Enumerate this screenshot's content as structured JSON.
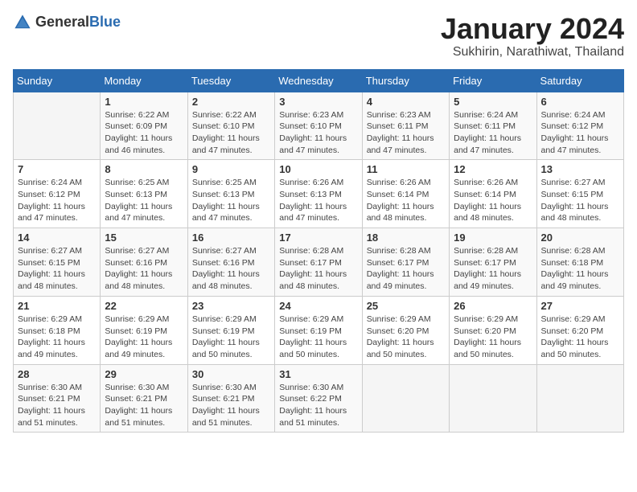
{
  "logo": {
    "text_general": "General",
    "text_blue": "Blue"
  },
  "title": "January 2024",
  "subtitle": "Sukhirin, Narathiwat, Thailand",
  "days_of_week": [
    "Sunday",
    "Monday",
    "Tuesday",
    "Wednesday",
    "Thursday",
    "Friday",
    "Saturday"
  ],
  "weeks": [
    [
      {
        "day": "",
        "detail": ""
      },
      {
        "day": "1",
        "detail": "Sunrise: 6:22 AM\nSunset: 6:09 PM\nDaylight: 11 hours\nand 46 minutes."
      },
      {
        "day": "2",
        "detail": "Sunrise: 6:22 AM\nSunset: 6:10 PM\nDaylight: 11 hours\nand 47 minutes."
      },
      {
        "day": "3",
        "detail": "Sunrise: 6:23 AM\nSunset: 6:10 PM\nDaylight: 11 hours\nand 47 minutes."
      },
      {
        "day": "4",
        "detail": "Sunrise: 6:23 AM\nSunset: 6:11 PM\nDaylight: 11 hours\nand 47 minutes."
      },
      {
        "day": "5",
        "detail": "Sunrise: 6:24 AM\nSunset: 6:11 PM\nDaylight: 11 hours\nand 47 minutes."
      },
      {
        "day": "6",
        "detail": "Sunrise: 6:24 AM\nSunset: 6:12 PM\nDaylight: 11 hours\nand 47 minutes."
      }
    ],
    [
      {
        "day": "7",
        "detail": "Sunrise: 6:24 AM\nSunset: 6:12 PM\nDaylight: 11 hours\nand 47 minutes."
      },
      {
        "day": "8",
        "detail": "Sunrise: 6:25 AM\nSunset: 6:13 PM\nDaylight: 11 hours\nand 47 minutes."
      },
      {
        "day": "9",
        "detail": "Sunrise: 6:25 AM\nSunset: 6:13 PM\nDaylight: 11 hours\nand 47 minutes."
      },
      {
        "day": "10",
        "detail": "Sunrise: 6:26 AM\nSunset: 6:13 PM\nDaylight: 11 hours\nand 47 minutes."
      },
      {
        "day": "11",
        "detail": "Sunrise: 6:26 AM\nSunset: 6:14 PM\nDaylight: 11 hours\nand 48 minutes."
      },
      {
        "day": "12",
        "detail": "Sunrise: 6:26 AM\nSunset: 6:14 PM\nDaylight: 11 hours\nand 48 minutes."
      },
      {
        "day": "13",
        "detail": "Sunrise: 6:27 AM\nSunset: 6:15 PM\nDaylight: 11 hours\nand 48 minutes."
      }
    ],
    [
      {
        "day": "14",
        "detail": "Sunrise: 6:27 AM\nSunset: 6:15 PM\nDaylight: 11 hours\nand 48 minutes."
      },
      {
        "day": "15",
        "detail": "Sunrise: 6:27 AM\nSunset: 6:16 PM\nDaylight: 11 hours\nand 48 minutes."
      },
      {
        "day": "16",
        "detail": "Sunrise: 6:27 AM\nSunset: 6:16 PM\nDaylight: 11 hours\nand 48 minutes."
      },
      {
        "day": "17",
        "detail": "Sunrise: 6:28 AM\nSunset: 6:17 PM\nDaylight: 11 hours\nand 48 minutes."
      },
      {
        "day": "18",
        "detail": "Sunrise: 6:28 AM\nSunset: 6:17 PM\nDaylight: 11 hours\nand 49 minutes."
      },
      {
        "day": "19",
        "detail": "Sunrise: 6:28 AM\nSunset: 6:17 PM\nDaylight: 11 hours\nand 49 minutes."
      },
      {
        "day": "20",
        "detail": "Sunrise: 6:28 AM\nSunset: 6:18 PM\nDaylight: 11 hours\nand 49 minutes."
      }
    ],
    [
      {
        "day": "21",
        "detail": "Sunrise: 6:29 AM\nSunset: 6:18 PM\nDaylight: 11 hours\nand 49 minutes."
      },
      {
        "day": "22",
        "detail": "Sunrise: 6:29 AM\nSunset: 6:19 PM\nDaylight: 11 hours\nand 49 minutes."
      },
      {
        "day": "23",
        "detail": "Sunrise: 6:29 AM\nSunset: 6:19 PM\nDaylight: 11 hours\nand 50 minutes."
      },
      {
        "day": "24",
        "detail": "Sunrise: 6:29 AM\nSunset: 6:19 PM\nDaylight: 11 hours\nand 50 minutes."
      },
      {
        "day": "25",
        "detail": "Sunrise: 6:29 AM\nSunset: 6:20 PM\nDaylight: 11 hours\nand 50 minutes."
      },
      {
        "day": "26",
        "detail": "Sunrise: 6:29 AM\nSunset: 6:20 PM\nDaylight: 11 hours\nand 50 minutes."
      },
      {
        "day": "27",
        "detail": "Sunrise: 6:29 AM\nSunset: 6:20 PM\nDaylight: 11 hours\nand 50 minutes."
      }
    ],
    [
      {
        "day": "28",
        "detail": "Sunrise: 6:30 AM\nSunset: 6:21 PM\nDaylight: 11 hours\nand 51 minutes."
      },
      {
        "day": "29",
        "detail": "Sunrise: 6:30 AM\nSunset: 6:21 PM\nDaylight: 11 hours\nand 51 minutes."
      },
      {
        "day": "30",
        "detail": "Sunrise: 6:30 AM\nSunset: 6:21 PM\nDaylight: 11 hours\nand 51 minutes."
      },
      {
        "day": "31",
        "detail": "Sunrise: 6:30 AM\nSunset: 6:22 PM\nDaylight: 11 hours\nand 51 minutes."
      },
      {
        "day": "",
        "detail": ""
      },
      {
        "day": "",
        "detail": ""
      },
      {
        "day": "",
        "detail": ""
      }
    ]
  ]
}
